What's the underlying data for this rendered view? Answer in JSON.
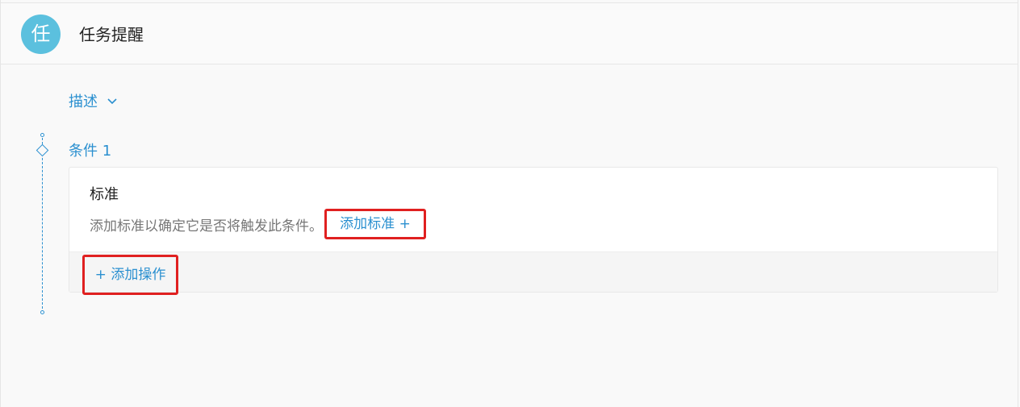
{
  "header": {
    "avatar_char": "任",
    "title": "任务提醒"
  },
  "description": {
    "label": "描述",
    "icon": "chevron-down-icon"
  },
  "condition": {
    "title": "条件 1",
    "criteria_label": "标准",
    "criteria_description": "添加标准以确定它是否将触发此条件。",
    "add_criteria_label": "添加标准 +",
    "add_action_label": "+ 添加操作"
  },
  "colors": {
    "accent": "#2b90d0",
    "avatar_bg": "#5bc0de",
    "highlight_box": "#e02020"
  }
}
